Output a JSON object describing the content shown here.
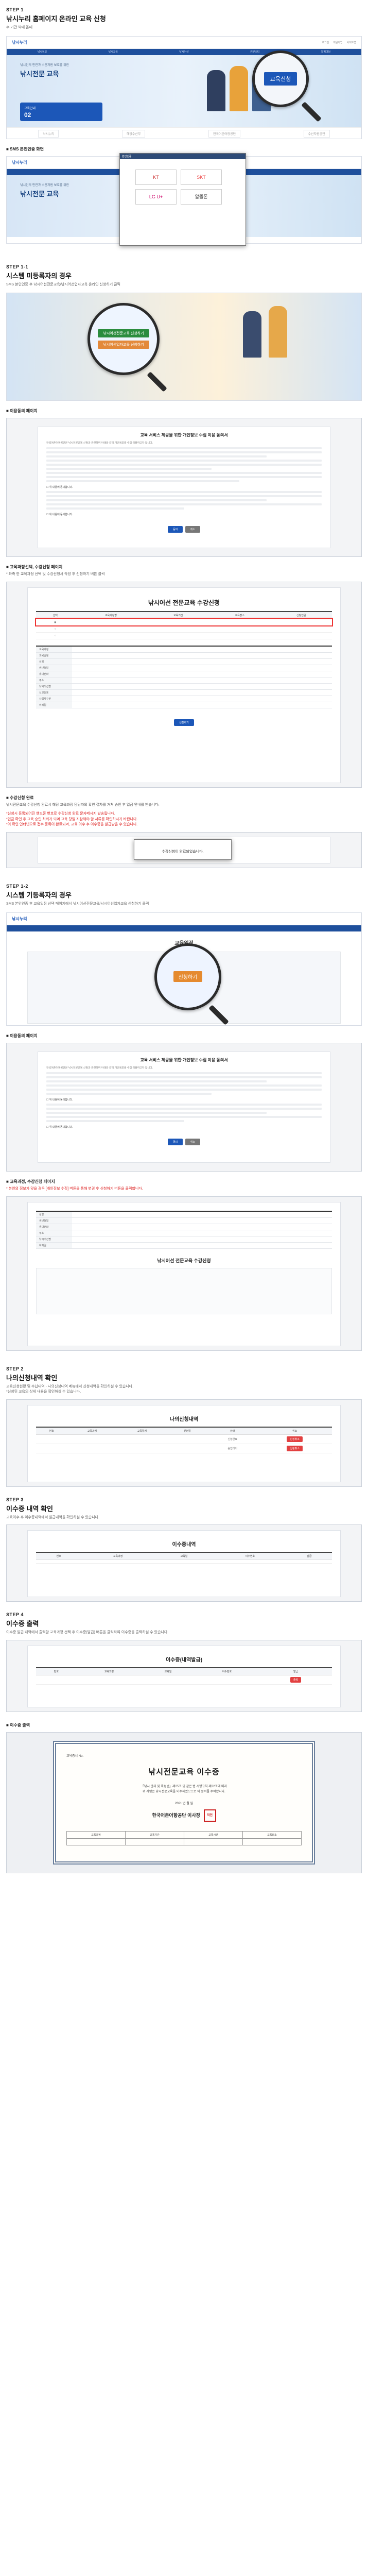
{
  "step1": {
    "label": "STEP 1",
    "title": "낚시누리 홈페이지 온라인 교육 신청",
    "desc": "수 기간 박때 올때"
  },
  "site": {
    "logo": "낚시누리",
    "top_links": [
      "로그인",
      "회원가입",
      "사이트맵"
    ],
    "nav": [
      "낚시정보",
      "낚시교육",
      "낚시어선",
      "커뮤니티",
      "알림마당"
    ],
    "hero_sub": "낚시인의 안전과 수산자원 보호를 위한",
    "hero_title": "낚시전문 교육",
    "hero_btn": "교육신청",
    "card_label": "교육안내",
    "card_value": "02",
    "foot": [
      "낚시누리",
      "해양수산부",
      "한국어촌어항공단",
      "수산자원공단"
    ],
    "mag_text": "교육신청"
  },
  "popup1": {
    "bullet": "SMS 본인인증 화면",
    "title": "본인인증",
    "options": [
      "KT",
      "SKT",
      "LG U+",
      "알뜰폰"
    ]
  },
  "step1_1": {
    "label": "STEP 1-1",
    "title": "시스템 미등록자의 경우",
    "desc": "SMS 본인인증 후 낚시어선전문교육/낚시어선업자교육 온라인 신청하기 클릭",
    "mag_lines": [
      "낚시어선전문교육 신청하기",
      "낚시어선업자교육 신청하기"
    ]
  },
  "agree": {
    "bullet": "이용동의 페이지",
    "head": "교육 서비스 제공을 위한 개인정보 수집 이용 동의서",
    "text": "한국어촌어항공단은 낚시전문교육 신청과 관련하여 아래와 같이 개인정보를 수집 이용하고자 합니다.",
    "check": "위 내용에 동의합니다.",
    "btn_ok": "동의",
    "btn_no": "취소"
  },
  "apply": {
    "bullet": "교육과정선택, 수강신청 페이지",
    "desc": "* 좌측 한 교육과정 선택 및 수강신청서 작성 후 신청하기 버튼 클릭",
    "title": "낚시어선 전문교육 수강신청",
    "rows": [
      "교육과정",
      "교육일정",
      "성명",
      "생년월일",
      "휴대전화",
      "주소",
      "낚시어선명",
      "신고번호",
      "사업자구분",
      "이메일"
    ],
    "cols": [
      "선택",
      "교육과정명",
      "교육기간",
      "교육장소",
      "신청인원"
    ],
    "submit": "신청하기"
  },
  "complete": {
    "bullet": "수강신청 완료",
    "desc": "낚시전문교육 수강신청 완료시 해당 교육과정 담당자의 확인 절차를 거쳐 승인 후 입금 안내를 받습니다.",
    "note1": "*신청시 등록되어진 핸드폰 번호로 수강신청 완료 문자메시지 발송됩니다.",
    "note2": "*입금 확인 후 교육 승인 처리가 되며 교육 당일 지참해야 할 서류를 확인하시기 바랍니다.",
    "note3": "*이 확인 인터넷으로 접수 등록이 완료되며, 교육 이수 후 이수증을 발급받을 수 있습니다.",
    "popup_text": "수강신청이 완료되었습니다."
  },
  "step1_2": {
    "label": "STEP 1-2",
    "title": "시스템 기등록자의 경우",
    "desc": "SMS 본인인증 후 교육일정 선택 페이지에서 낚시어선전문교육/낚시어선업자교육 신청하기 클릭",
    "page_title": "교육일정",
    "mag_text": "신청하기"
  },
  "agree2": {
    "bullet": "이용동의 페이지"
  },
  "apply2": {
    "bullet": "교육과정, 수강신청 페이지",
    "desc": "* 본인의 정보가 맞을 경우 [개인정보 수정] 버튼을 통해 변경 후 신청하기 버튼을 클릭합니다.",
    "title": "낚시어선 전문교육 수강신청"
  },
  "step2": {
    "label": "STEP 2",
    "title": "나의신청내역 확인",
    "desc": "교육신청현황 및 수납내역 - 나의신청내역 메뉴에서 신청내역을 확인하실 수 있습니다.",
    "desc2": "*신청된 교육의 상세 내용을 확인하실 수 있습니다.",
    "panel": "나의신청내역",
    "cols": [
      "번호",
      "교육과정",
      "교육일정",
      "신청일",
      "상태",
      "취소"
    ],
    "status": [
      "신청완료",
      "승인대기"
    ],
    "cancel": "신청취소"
  },
  "step3": {
    "label": "STEP 3",
    "title": "이수증 내역 확인",
    "desc": "교육이수 후 이수증내역에서 발급내역을 확인하실 수 있습니다.",
    "panel": "이수증내역",
    "cols": [
      "번호",
      "교육과정",
      "교육일",
      "이수번호",
      "발급"
    ]
  },
  "step4": {
    "label": "STEP 4",
    "title": "이수증 출력",
    "desc": "이수증 발급 내역에서 출력할 교육과정 선택 후 이수증(발급) 버튼을 클릭하여 이수증을 출력하실 수 있습니다.",
    "panel": "이수증(내역발급)",
    "btn": "출력"
  },
  "certificate": {
    "bullet": "이수증 출력",
    "no": "교육증서 No.",
    "title": "낚시전문교육 이수증",
    "body1": "「낚시 관리 및 육성법」제25조 및 같은 법 시행규칙 제22조에 따라",
    "body2": "위 사람은 낚시전문교육을 이수하였으므로 이 증서를 수여합니다.",
    "date": "2021 년 월 일",
    "sign": "한국어촌어항공단 이사장",
    "stamp": "직인",
    "table_head": [
      "교육과정",
      "교육기간",
      "교육시간",
      "교육장소"
    ]
  },
  "colors": {
    "brand": "#1c57b8",
    "nav": "#1e4f9c",
    "alert": "#e33333"
  },
  "icons": [
    "magnifier-icon",
    "check-icon"
  ]
}
